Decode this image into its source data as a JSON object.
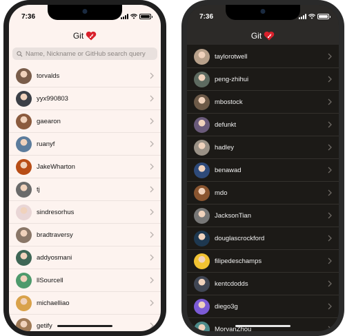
{
  "light": {
    "time": "7:36",
    "title": "Git",
    "search_placeholder": "Name, Nickname or GitHub search query",
    "users": [
      {
        "name": "torvalds",
        "color": "#7a5d4a"
      },
      {
        "name": "yyx990803",
        "color": "#3b3f46"
      },
      {
        "name": "gaearon",
        "color": "#8b5b3e"
      },
      {
        "name": "ruanyf",
        "color": "#5c7c9c"
      },
      {
        "name": "JakeWharton",
        "color": "#b84d16"
      },
      {
        "name": "tj",
        "color": "#6a6a6a"
      },
      {
        "name": "sindresorhus",
        "color": "#e9d6d6"
      },
      {
        "name": "bradtraversy",
        "color": "#8a7768"
      },
      {
        "name": "addyosmani",
        "color": "#3e6655"
      },
      {
        "name": "llSourcell",
        "color": "#4e9a6c"
      },
      {
        "name": "michaelliao",
        "color": "#d9a24a"
      },
      {
        "name": "getify",
        "color": "#a07a56"
      }
    ]
  },
  "dark": {
    "time": "7:36",
    "title": "Git",
    "users": [
      {
        "name": "taylorotwell",
        "color": "#b7a08a"
      },
      {
        "name": "peng-zhihui",
        "color": "#5d6a60"
      },
      {
        "name": "mbostock",
        "color": "#6d5a48"
      },
      {
        "name": "defunkt",
        "color": "#6a5a7a"
      },
      {
        "name": "hadley",
        "color": "#9a9186"
      },
      {
        "name": "benawad",
        "color": "#2e4a7a"
      },
      {
        "name": "mdo",
        "color": "#8a5530"
      },
      {
        "name": "JacksonTian",
        "color": "#777777"
      },
      {
        "name": "douglascrockford",
        "color": "#1e3850"
      },
      {
        "name": "filipedeschamps",
        "color": "#f1c232"
      },
      {
        "name": "kentcdodds",
        "color": "#404654"
      },
      {
        "name": "diego3g",
        "color": "#7c5bd6"
      },
      {
        "name": "MorvanZhou",
        "color": "#4d8b8a"
      }
    ]
  }
}
